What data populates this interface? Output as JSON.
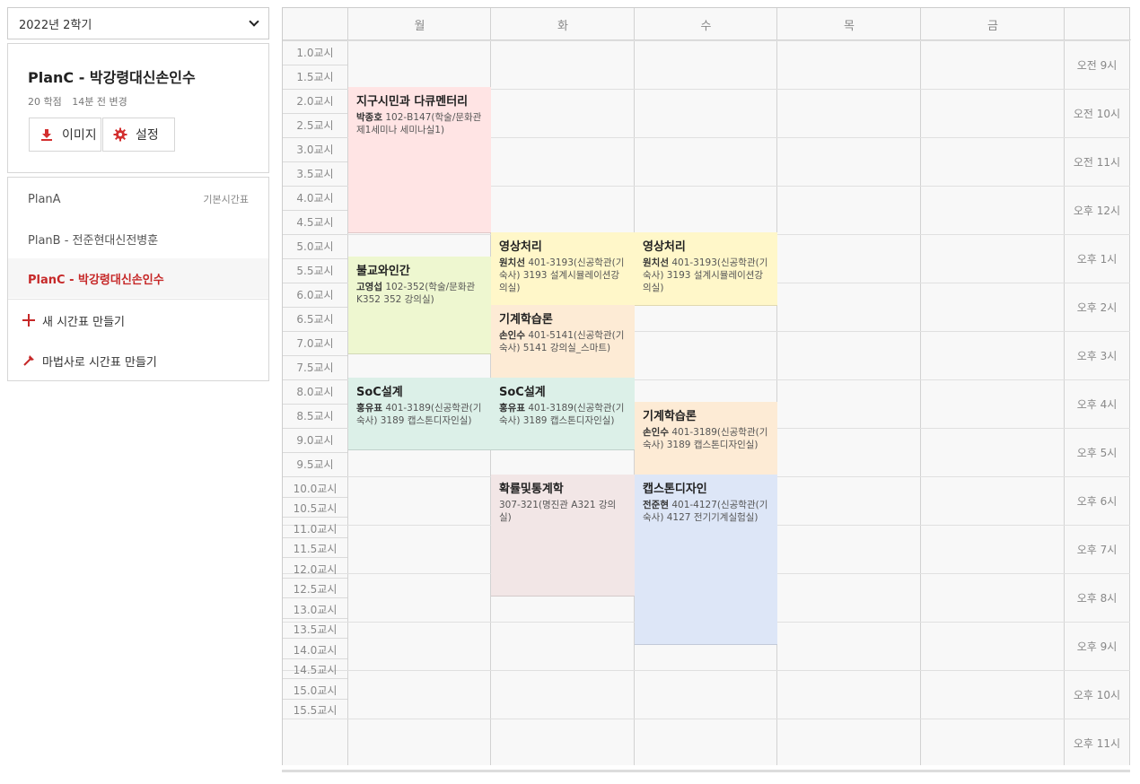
{
  "sidebar": {
    "semester": "2022년 2학기",
    "plan_title": "PlanC - 박강령대신손인수",
    "credits": "20 학점",
    "modified": "14분 전 변경",
    "btn_image": "이미지",
    "btn_settings": "설정",
    "plans": [
      {
        "label": "PlanA",
        "tag": "기본시간표"
      },
      {
        "label": "PlanB - 전준현대신전병훈",
        "tag": ""
      },
      {
        "label": "PlanC - 박강령대신손인수",
        "tag": ""
      }
    ],
    "new_timetable": "새 시간표 만들기",
    "wizard_timetable": "마법사로 시간표 만들기"
  },
  "timetable": {
    "days": [
      "월",
      "화",
      "수",
      "목",
      "금"
    ],
    "periods": [
      "1.0교시",
      "1.5교시",
      "2.0교시",
      "2.5교시",
      "3.0교시",
      "3.5교시",
      "4.0교시",
      "4.5교시",
      "5.0교시",
      "5.5교시",
      "6.0교시",
      "6.5교시",
      "7.0교시",
      "7.5교시",
      "8.0교시",
      "8.5교시",
      "9.0교시",
      "9.5교시",
      "10.0교시",
      "10.5교시",
      "11.0교시",
      "11.5교시",
      "12.0교시",
      "12.5교시",
      "13.0교시",
      "13.5교시",
      "14.0교시",
      "14.5교시",
      "15.0교시",
      "15.5교시"
    ],
    "times": [
      "오전 9시",
      "오전 10시",
      "오전 11시",
      "오후 12시",
      "오후 1시",
      "오후 2시",
      "오후 3시",
      "오후 4시",
      "오후 5시",
      "오후 6시",
      "오후 7시",
      "오후 8시",
      "오후 9시",
      "오후 10시",
      "오후 11시"
    ],
    "classes": [
      {
        "name": "지구시민과 다큐멘터리",
        "prof": "박종호",
        "room": "102-B147(학술/문화관 제1세미나 세미나실1)",
        "color": "#ffe4e4"
      },
      {
        "name": "불교와인간",
        "prof": "고영섭",
        "room": "102-352(학술/문화관 K352 352 강의실)",
        "color": "#eef7d0"
      },
      {
        "name": "SoC설계",
        "prof": "홍유표",
        "room": "401-3189(신공학관(기숙사) 3189 캡스톤디자인실)",
        "color": "#dcf0e8"
      },
      {
        "name": "영상처리",
        "prof": "원치선",
        "room": "401-3193(신공학관(기숙사) 3193 설계시뮬레이션강의실)",
        "color": "#fff7c9"
      },
      {
        "name": "기계학습론",
        "prof": "손인수",
        "room": "401-5141(신공학관(기숙사) 5141 강의실_스마트)",
        "color": "#fdebd5"
      },
      {
        "name": "SoC설계",
        "prof": "홍유표",
        "room": "401-3189(신공학관(기숙사) 3189 캡스톤디자인실)",
        "color": "#dcf0e8"
      },
      {
        "name": "확률및통계학",
        "prof": "",
        "room": "307-321(명진관 A321 강의실)",
        "color": "#f2e6e6"
      },
      {
        "name": "영상처리",
        "prof": "원치선",
        "room": "401-3193(신공학관(기숙사) 3193 설계시뮬레이션강의실)",
        "color": "#fff7c9"
      },
      {
        "name": "기계학습론",
        "prof": "손인수",
        "room": "401-3189(신공학관(기숙사) 3189 캡스톤디자인실)",
        "color": "#fdebd5"
      },
      {
        "name": "캡스톤디자인",
        "prof": "전준현",
        "room": "401-4127(신공학관(기숙사) 4127 전기기계실험실)",
        "color": "#dde6f7"
      }
    ]
  }
}
